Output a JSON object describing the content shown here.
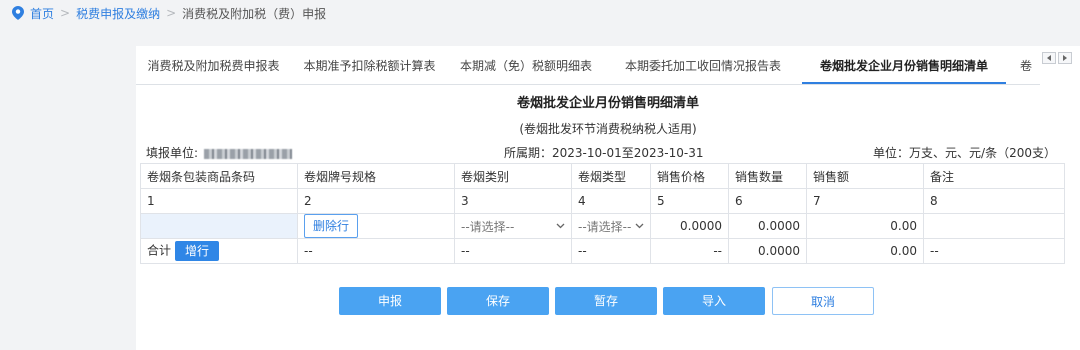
{
  "breadcrumb": {
    "home": "首页",
    "parent": "税费申报及缴纳",
    "current": "消费税及附加税（费）申报"
  },
  "tabs": [
    {
      "label": "消费税及附加税费申报表"
    },
    {
      "label": "本期准予扣除税额计算表"
    },
    {
      "label": "本期减（免）税额明细表"
    },
    {
      "label": "本期委托加工收回情况报告表"
    },
    {
      "label": "卷烟批发企业月份销售明细清单",
      "active": true
    },
    {
      "label": "卷"
    }
  ],
  "form": {
    "title": "卷烟批发企业月份销售明细清单",
    "subtitle": "(卷烟批发环节消费税纳税人适用)",
    "unit_label": "填报单位:",
    "period": "所属期：2023-10-01至2023-10-31",
    "unit_scale": "单位：万支、元、元/条（200支）"
  },
  "table": {
    "headers": [
      "卷烟条包装商品条码",
      "卷烟牌号规格",
      "卷烟类别",
      "卷烟类型",
      "销售价格",
      "销售数量",
      "销售额",
      "备注"
    ],
    "numbers": [
      "1",
      "2",
      "3",
      "4",
      "5",
      "6",
      "7",
      "8"
    ],
    "input_row": {
      "delete_button": "删除行",
      "category_select": "--请选择--",
      "type_select": "--请选择--",
      "price": "0.0000",
      "quantity": "0.0000",
      "amount": "0.00"
    },
    "total_row": {
      "label": "合计",
      "add_button": "增行",
      "brand": "--",
      "category": "--",
      "type": "--",
      "price": "--",
      "quantity": "0.0000",
      "amount": "0.00",
      "note": "--"
    }
  },
  "actions": {
    "submit": "申报",
    "save": "保存",
    "stash": "暂存",
    "import": "导入",
    "cancel": "取消"
  },
  "colors": {
    "accent": "#2f7fe0",
    "button": "#4aa3f2",
    "background": "#f2f3f5"
  }
}
